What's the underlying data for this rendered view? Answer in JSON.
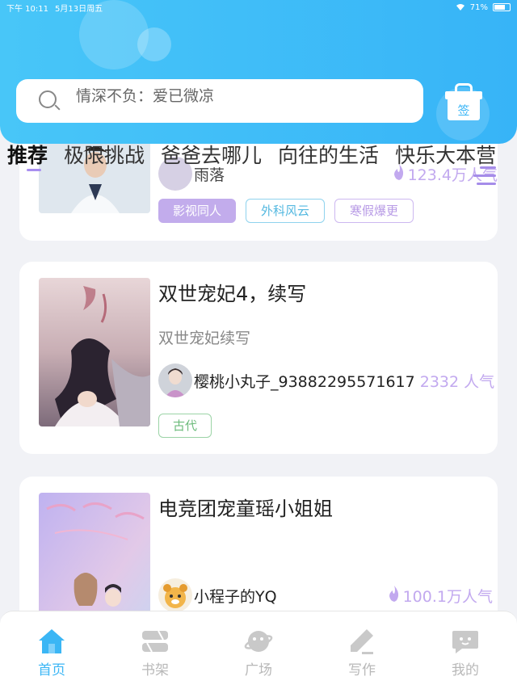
{
  "status_bar": {
    "time": "下午 10:11",
    "date": "5月13日周五",
    "battery": "71%",
    "battery_level": 0.71
  },
  "search": {
    "placeholder": "情深不负：爱已微凉"
  },
  "sign_button": {
    "label": "签"
  },
  "tabs": [
    {
      "label": "推荐",
      "active": true
    },
    {
      "label": "极限挑战",
      "active": false
    },
    {
      "label": "爸爸去哪儿",
      "active": false
    },
    {
      "label": "向往的生活",
      "active": false
    },
    {
      "label": "快乐大本营",
      "active": false
    }
  ],
  "cards": [
    {
      "author": "雨落",
      "popularity": "123.4万人气",
      "tags": [
        "影视同人",
        "外科风云",
        "寒假爆更"
      ]
    },
    {
      "title": "双世宠妃4，续写",
      "description": "双世宠妃续写",
      "author": "樱桃小丸子_93882295571617",
      "popularity": "2332 人气",
      "tags": [
        "古代"
      ]
    },
    {
      "title": "电竞团宠童瑶小姐姐",
      "author": "小程子的YQ",
      "popularity": "100.1万人气"
    }
  ],
  "bottom_nav": [
    {
      "label": "首页",
      "icon": "home-icon",
      "active": true
    },
    {
      "label": "书架",
      "icon": "bookshelf-icon",
      "active": false
    },
    {
      "label": "广场",
      "icon": "planet-icon",
      "active": false
    },
    {
      "label": "写作",
      "icon": "pen-icon",
      "active": false
    },
    {
      "label": "我的",
      "icon": "chat-face-icon",
      "active": false
    }
  ],
  "colors": {
    "header": "#3db9f7",
    "accent_purple": "#a98ff0",
    "tag_green": "#7ac48a",
    "nav_active": "#3bb6f5"
  }
}
